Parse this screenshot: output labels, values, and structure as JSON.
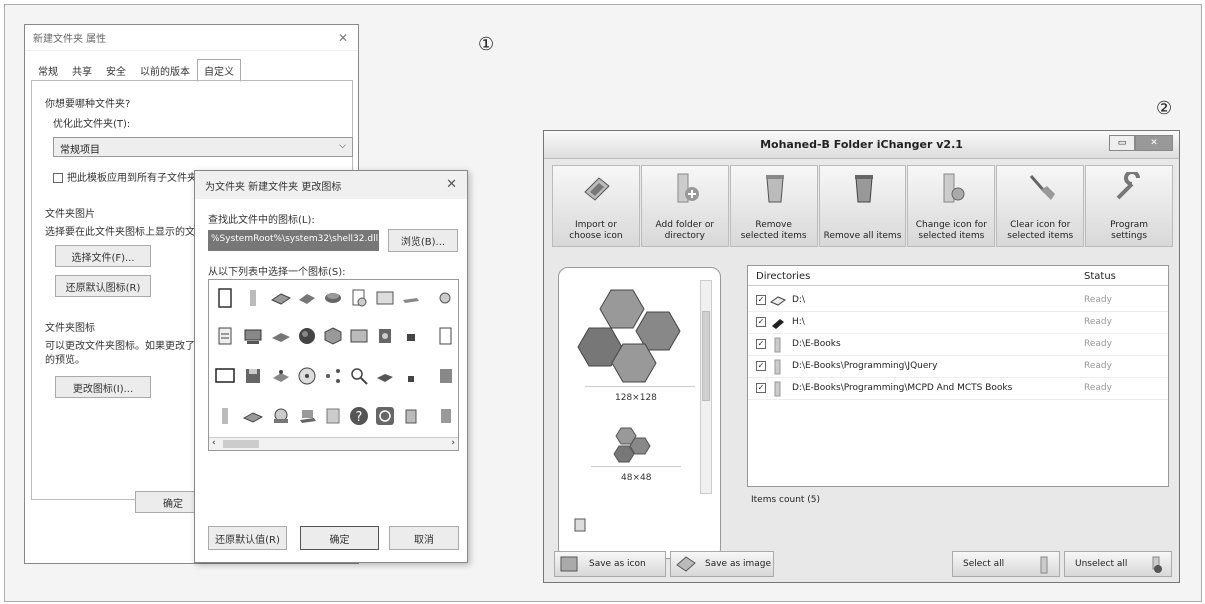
{
  "markers": {
    "one": "①",
    "two": "②"
  },
  "props_dialog": {
    "title": "新建文件夹 属性",
    "tabs": [
      "常规",
      "共享",
      "安全",
      "以前的版本",
      "自定义"
    ],
    "question": "你想要哪种文件夹?",
    "optimize_label": "优化此文件夹(T):",
    "optimize_value": "常规项目",
    "apply_sub_label": "把此模板应用到所有子文件夹(S",
    "pictures_group": "文件夹图片",
    "pictures_desc": "选择要在此文件夹图标上显示的文",
    "choose_file": "选择文件(F)...",
    "restore_default": "还原默认图标(R)",
    "icons_group": "文件夹图标",
    "icons_desc_1": "可以更改文件夹图标。如果更改了",
    "icons_desc_2": "的预览。",
    "change_icon": "更改图标(I)...",
    "ok": "确定"
  },
  "icon_dialog": {
    "title": "为文件夹 新建文件夹 更改图标",
    "find_label": "查找此文件中的图标(L):",
    "path_value": "%SystemRoot%\\system32\\shell32.dll",
    "browse": "浏览(B)...",
    "select_label": "从以下列表中选择一个图标(S):",
    "restore": "还原默认值(R)",
    "ok": "确定",
    "cancel": "取消"
  },
  "ichanger": {
    "title": "Mohaned-B Folder iChanger v2.1",
    "toolbar": [
      {
        "line1": "Import or",
        "line2": "choose icon",
        "icon": "image-icon"
      },
      {
        "line1": "Add folder or",
        "line2": "directory",
        "icon": "add-folder-icon"
      },
      {
        "line1": "Remove",
        "line2": "selected items",
        "icon": "recycle-bin-icon"
      },
      {
        "line1": "",
        "line2": "Remove all items",
        "icon": "recycle-bin-full-icon"
      },
      {
        "line1": "Change icon for",
        "line2": "selected items",
        "icon": "gear-folder-icon"
      },
      {
        "line1": "Clear icon for",
        "line2": "selected items",
        "icon": "broom-icon"
      },
      {
        "line1": "Program",
        "line2": "settings",
        "icon": "wrench-icon"
      }
    ],
    "preview_large": "128×128",
    "preview_small": "48×48",
    "list_headers": {
      "directories": "Directories",
      "status": "Status"
    },
    "rows": [
      {
        "path": "D:\\",
        "status": "Ready",
        "icon": "drive-icon"
      },
      {
        "path": "H:\\",
        "status": "Ready",
        "icon": "usb-drive-icon"
      },
      {
        "path": "D:\\E-Books",
        "status": "Ready",
        "icon": "folder-icon"
      },
      {
        "path": "D:\\E-Books\\Programming\\JQuery",
        "status": "Ready",
        "icon": "folder-icon"
      },
      {
        "path": "D:\\E-Books\\Programming\\MCPD And MCTS Books",
        "status": "Ready",
        "icon": "folder-icon"
      }
    ],
    "items_count": "Items count (5)",
    "save_icon": "Save as icon",
    "save_image": "Save as image",
    "select_all": "Select all",
    "unselect_all": "Unselect all"
  }
}
